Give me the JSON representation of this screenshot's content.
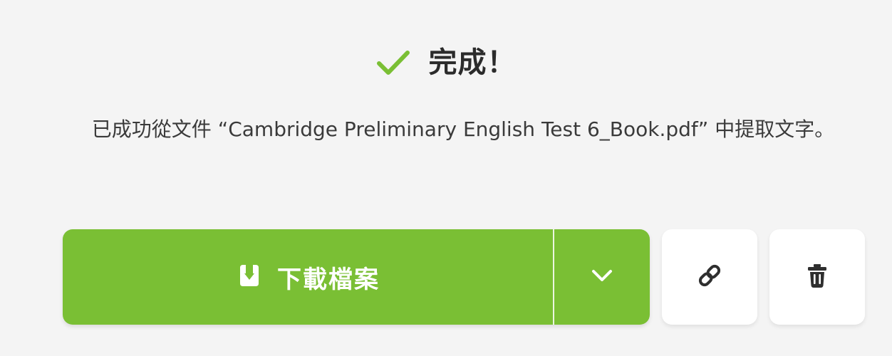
{
  "status": {
    "title": "完成！",
    "icon": "check-icon",
    "accent_color": "#7abf34"
  },
  "message": {
    "text": "已成功從文件 “Cambridge Preliminary English Test 6_Book.pdf” 中提取文字。"
  },
  "actions": {
    "download": {
      "label": "下載檔案",
      "icon": "download-icon",
      "background": "#7abf34"
    },
    "dropdown": {
      "icon": "chevron-down-icon"
    },
    "share_link": {
      "icon": "link-icon"
    },
    "delete": {
      "icon": "trash-icon"
    }
  }
}
